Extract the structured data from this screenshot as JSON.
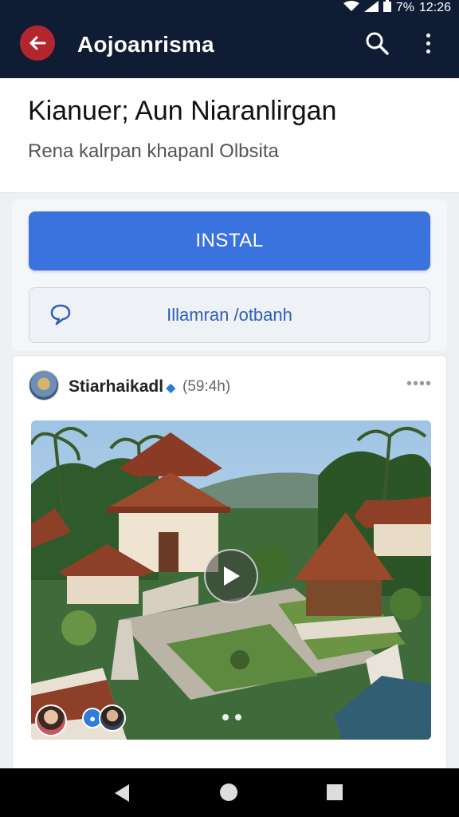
{
  "status_bar": {
    "time": "12:26",
    "battery": "7%"
  },
  "app_bar": {
    "title": "Aojoanrisma"
  },
  "header": {
    "title": "Kianuer; Aun Niaranlirgan",
    "subtitle": "Rena kalrpan khapanl Olbsita"
  },
  "actions": {
    "install_label": "INSTAL",
    "chat_label": "Illamran /otbanh"
  },
  "post": {
    "author": "Stiarhaikadl",
    "time_ago": "(59:4h)",
    "more_label": "••••"
  },
  "colors": {
    "app_bar": "#0f1c33",
    "back_button": "#b3262e",
    "install_button": "#3b73de",
    "chat_text": "#2f5fb8"
  }
}
